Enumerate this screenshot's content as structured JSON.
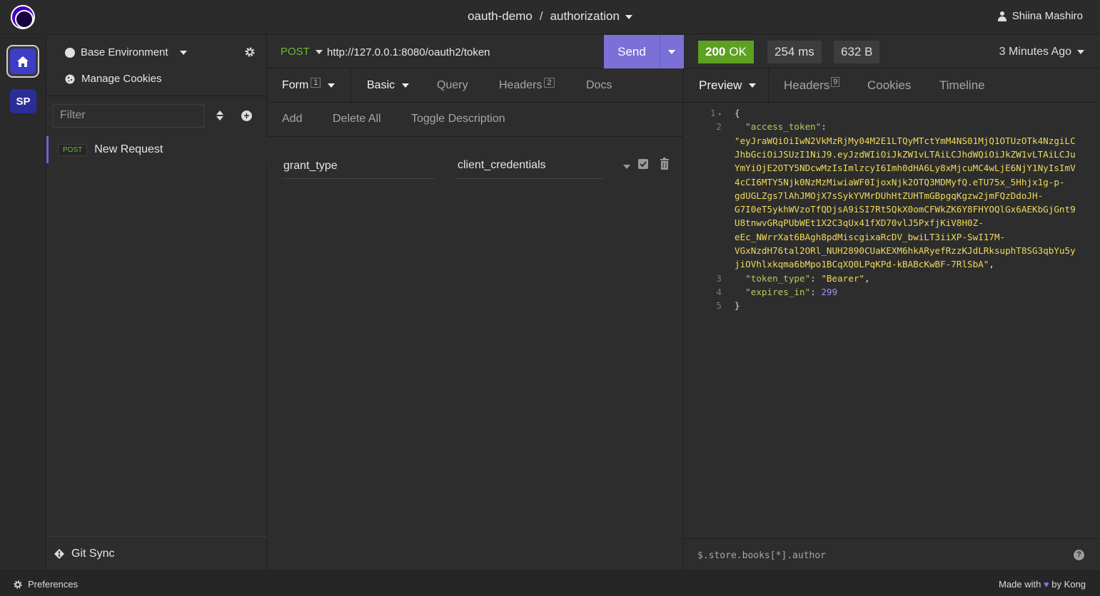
{
  "header": {
    "project": "oauth-demo",
    "separator": "/",
    "collection": "authorization",
    "user": "Shiina Mashiro"
  },
  "rail": {
    "workspace_badge": "SP"
  },
  "sidebar": {
    "environment": "Base Environment",
    "manage_cookies": "Manage Cookies",
    "filter_placeholder": "Filter",
    "requests": [
      {
        "method": "POST",
        "name": "New Request"
      }
    ],
    "git_sync": "Git Sync"
  },
  "request": {
    "method": "POST",
    "url": "http://127.0.0.1:8080/oauth2/token",
    "send_label": "Send",
    "tabs": {
      "form": "Form",
      "form_count": "1",
      "basic": "Basic",
      "query": "Query",
      "headers": "Headers",
      "headers_count": "2",
      "docs": "Docs"
    },
    "actions": {
      "add": "Add",
      "delete_all": "Delete All",
      "toggle_description": "Toggle Description"
    },
    "params": [
      {
        "key": "grant_type",
        "value": "client_credentials"
      }
    ]
  },
  "response": {
    "status_code": "200",
    "status_text": "OK",
    "time": "254 ms",
    "size": "632 B",
    "ago": "3 Minutes Ago",
    "tabs": {
      "preview": "Preview",
      "headers": "Headers",
      "headers_count": "9",
      "cookies": "Cookies",
      "timeline": "Timeline"
    },
    "body": {
      "line_numbers": [
        "1",
        "2",
        "3",
        "4",
        "5"
      ],
      "open_brace": "{",
      "close_brace": "}",
      "access_token_key": "\"access_token\"",
      "access_token_lines": [
        "\"eyJraWQiOiIwN2VkMzRjMy04M2E1LTQyMTctYmM4NS01MjQ1OTUzOTk4NzgiLC",
        "JhbGciOiJSUzI1NiJ9.eyJzdWIiOiJkZW1vLTAiLCJhdWQiOiJkZW1vLTAiLCJu",
        "YmYiOjE2OTY5NDcwMzIsImlzcyI6Imh0dHA6Ly8xMjcuMC4wLjE6NjY1NyIsImV",
        "4cCI6MTY5Njk0NzMzMiwiaWF0IjoxNjk2OTQ3MDMyfQ.eTU75x_5Hhjx1g-p-",
        "gdUGLZgs7lAhJMOjX7sSykYVMrDUhHtZUHTmGBpgqKgzw2jmFQzDdoJH-",
        "G7I0eT5ykhWVzoTfQDjsA9iSI7Rt5QkX0omCFWkZK6Y8FHYOQlGx6AEKbGjGnt9",
        "U8tnwvGRqPUbWEt1X2C3qUx41fXD70vlJ5PxfjKiV8H0Z-",
        "eEc_NWrrXat6BAgh8pdMiscgixaRcDV_bwiLT3iiXP-SwI17M-",
        "VGxNzdH76tal2ORl_NUH2890CUaKEXM6hkARyefRzzKJdLRksuphT8SG3qbYu5y",
        "jiOVhlxkqma6bMpo1BCqXQ0LPqKPd-kBABcKwBF-7RlSbA\""
      ],
      "token_type_key": "\"token_type\"",
      "token_type_value": "\"Bearer\"",
      "expires_in_key": "\"expires_in\"",
      "expires_in_value": "299"
    },
    "filter_query": "$.store.books[*].author"
  },
  "statusbar": {
    "preferences": "Preferences",
    "made_with": "Made with",
    "by": "by Kong"
  },
  "colors": {
    "accent": "#7b6fd8",
    "status_ok": "#5da122",
    "method_post": "#6db93f",
    "json_key": "#b2cc5b",
    "json_string": "#f0d95c",
    "json_number": "#a78bfa"
  },
  "icons": [
    "logo-icon",
    "user-icon",
    "home-icon",
    "gear-icon",
    "cookie-icon",
    "sort-icon",
    "plus-circle-icon",
    "git-icon",
    "chevron-down-icon",
    "checkbox-icon",
    "trash-icon",
    "help-icon",
    "heart-icon"
  ]
}
